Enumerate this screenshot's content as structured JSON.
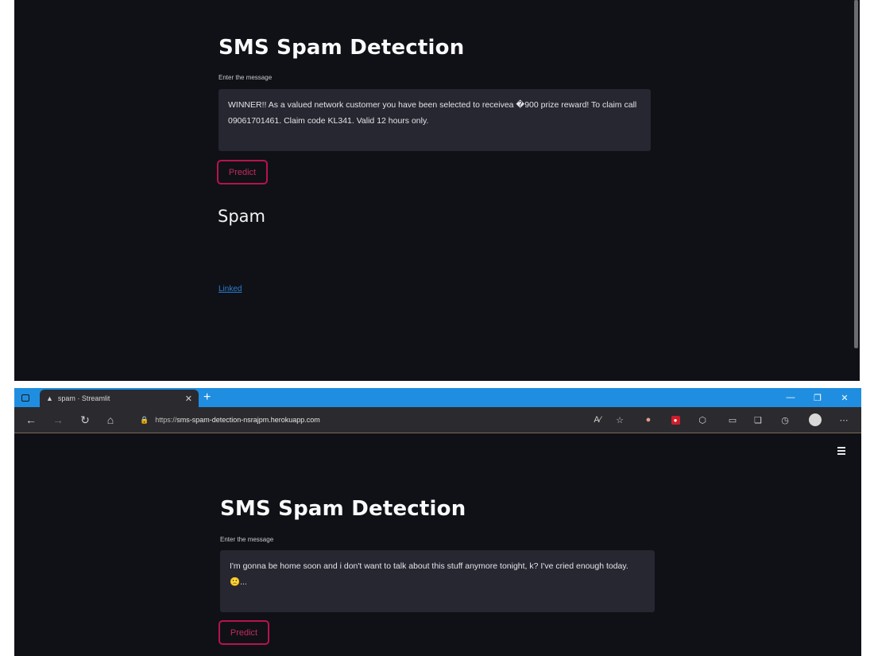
{
  "top_app": {
    "title": "SMS Spam Detection",
    "input_label": "Enter the message",
    "message": "WINNER!! As a valued network customer you have been selected to receivea �900 prize reward! To claim call 09061701461. Claim code KL341. Valid 12 hours only.",
    "predict_label": "Predict",
    "result": "Spam",
    "link_label": "Linked"
  },
  "browser": {
    "tab_title": "spam · Streamlit",
    "tab_close": "✕",
    "new_tab": "+",
    "url_prefix": "https://",
    "url_host": "sms-spam-detection-nsrajpm.herokuapp.com",
    "window_controls": [
      "—",
      "❐",
      "✕"
    ],
    "icons": {
      "back": "arrow-left-icon",
      "forward": "arrow-right-icon",
      "reload": "reload-icon",
      "home": "home-icon",
      "lock": "lock-icon",
      "read_aloud": "read-aloud-icon",
      "favorite": "star-icon",
      "menu": "ellipsis-icon"
    }
  },
  "bottom_app": {
    "title": "SMS Spam Detection",
    "input_label": "Enter the message",
    "message": "I'm gonna be home soon and i don't want to talk about this stuff anymore tonight, k? I've cried enough today.🙁...",
    "predict_label": "Predict"
  },
  "colors": {
    "app_background": "#0f1117",
    "input_background": "#262730",
    "button_accent": "#b8134a",
    "link": "#2e7fd4",
    "browser_tabbar": "#1f8ee0",
    "browser_chrome": "#2b2b2f"
  }
}
